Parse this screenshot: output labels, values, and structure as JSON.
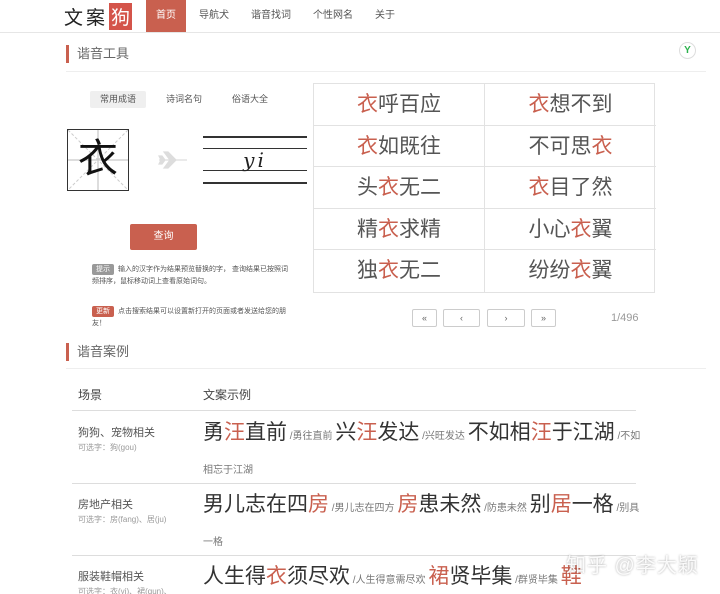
{
  "header": {
    "logo_text": "文案",
    "logo_boxed": "狗",
    "nav": [
      "首页",
      "导航犬",
      "谐音找词",
      "个性网名",
      "关于"
    ]
  },
  "tool": {
    "section_title": "谐音工具",
    "tabs": [
      "常用成语",
      "诗词名句",
      "俗语大全"
    ],
    "character": "衣",
    "pinyin": "yi",
    "query_label": "查询",
    "note1_tag": "提示",
    "note1_text": "输入的汉字作为结果预览替换的字， 查询结果已按照词频排序，鼠标移动词上查看原始词句。",
    "note2_tag": "更新",
    "note2_text": "点击搜索结果可以设置新打开的页面或者发送给您的朋友！",
    "page_count": "1/496",
    "pager": [
      "«",
      "‹",
      "›",
      "»"
    ]
  },
  "idioms": [
    {
      "pre": "",
      "hl": "衣",
      "post": "呼百应"
    },
    {
      "pre": "",
      "hl": "衣",
      "post": "想不到"
    },
    {
      "pre": "",
      "hl": "衣",
      "post": "如既往"
    },
    {
      "pre": "不可思",
      "hl": "衣",
      "post": ""
    },
    {
      "pre": "头",
      "hl": "衣",
      "post": "无二"
    },
    {
      "pre": "",
      "hl": "衣",
      "post": "目了然"
    },
    {
      "pre": "精",
      "hl": "衣",
      "post": "求精"
    },
    {
      "pre": "小心",
      "hl": "衣",
      "post": "翼"
    },
    {
      "pre": "独",
      "hl": "衣",
      "post": "无二"
    },
    {
      "pre": "纷纷",
      "hl": "衣",
      "post": "翼"
    }
  ],
  "cases": {
    "section_title": "谐音案例",
    "col_scene": "场景",
    "col_example": "文案示例",
    "rows": [
      {
        "scene": "狗狗、宠物相关",
        "sub": "可选字：狗(gou)",
        "line": [
          {
            "t": "勇",
            "hl": false
          },
          {
            "t": "汪",
            "hl": true
          },
          {
            "t": "直前",
            "hl": false
          },
          {
            "t": " /勇往直前 ",
            "small": true
          },
          {
            "t": "兴",
            "hl": false
          },
          {
            "t": "汪",
            "hl": true
          },
          {
            "t": "发达",
            "hl": false
          },
          {
            "t": " /兴旺发达 ",
            "small": true
          },
          {
            "t": "不如相",
            "hl": false
          },
          {
            "t": "汪",
            "hl": true
          },
          {
            "t": "于江湖",
            "hl": false
          },
          {
            "t": " /不如相忘于江湖",
            "small": true
          }
        ]
      },
      {
        "scene": "房地产相关",
        "sub": "可选字：房(fang)、居(ju)",
        "line": [
          {
            "t": "男儿志在四",
            "hl": false
          },
          {
            "t": "房",
            "hl": true
          },
          {
            "t": " /男儿志在四方 ",
            "small": true
          },
          {
            "t": "房",
            "hl": true
          },
          {
            "t": "患未然",
            "hl": false
          },
          {
            "t": " /防患未然 ",
            "small": true
          },
          {
            "t": "别",
            "hl": false
          },
          {
            "t": "居",
            "hl": true
          },
          {
            "t": "一格",
            "hl": false
          },
          {
            "t": " /别具一格",
            "small": true
          }
        ]
      },
      {
        "scene": "服装鞋帽相关",
        "sub": "可选字：衣(yi)、裙(qun)、",
        "line": [
          {
            "t": "人生得",
            "hl": false
          },
          {
            "t": "衣",
            "hl": true
          },
          {
            "t": "须尽欢",
            "hl": false
          },
          {
            "t": " /人生得意需尽欢 ",
            "small": true
          },
          {
            "t": "裙",
            "hl": true
          },
          {
            "t": "贤毕集",
            "hl": false
          },
          {
            "t": " /群贤毕集 ",
            "small": true
          },
          {
            "t": "鞋",
            "hl": true
          }
        ]
      }
    ]
  },
  "watermark": "知乎 @李大颖",
  "colors": {
    "accent": "#c9604f"
  }
}
